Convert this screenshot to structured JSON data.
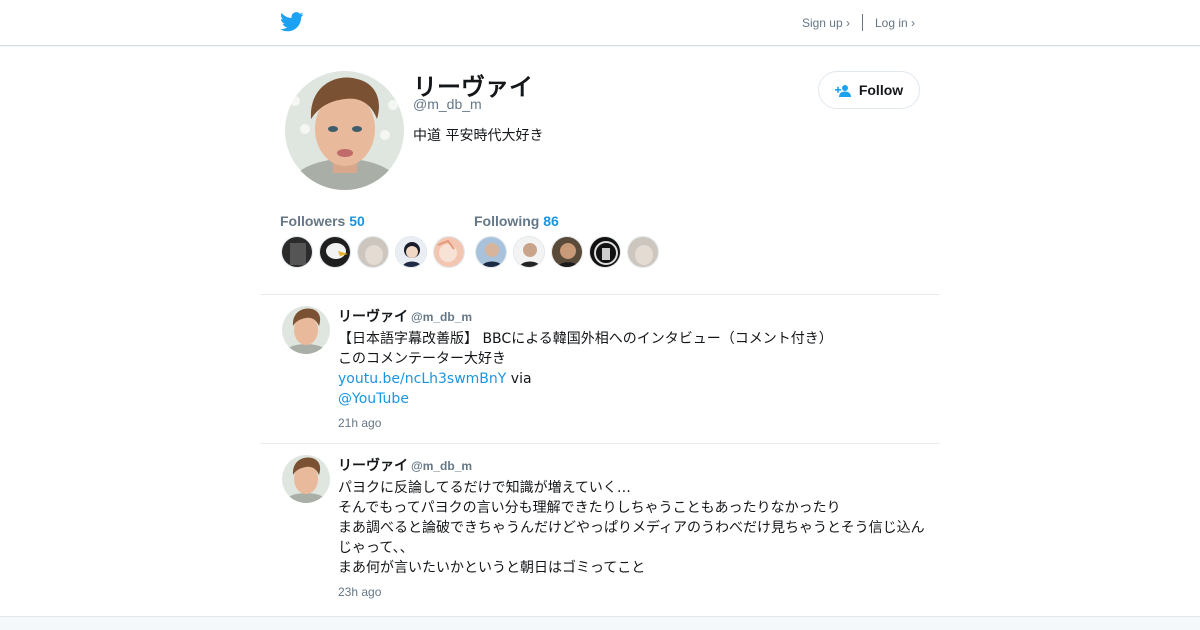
{
  "colors": {
    "accent": "#1b95e0",
    "twitter_blue": "#1da1f2",
    "muted": "#657786"
  },
  "header": {
    "logo_icon": "twitter-bird-icon",
    "signup_label": "Sign up ›",
    "login_label": "Log in ›"
  },
  "profile": {
    "name": "リーヴァイ",
    "handle": "@m_db_m",
    "bio": "中道 平安時代大好き",
    "follow_label": "Follow",
    "follow_icon": "add-user-icon",
    "followers_label": "Followers",
    "followers_count": "50",
    "following_label": "Following",
    "following_count": "86"
  },
  "tweets": [
    {
      "name": "リーヴァイ",
      "handle": "@m_db_m",
      "line1": "【日本語字幕改善版】 BBCによる韓国外相へのインタビュー（コメント付き）",
      "line2": "このコメンテーター大好き",
      "link": "youtu.be/ncLh3swmBnY",
      "via": " via",
      "mention": "@YouTube",
      "time": "21h ago"
    },
    {
      "name": "リーヴァイ",
      "handle": "@m_db_m",
      "line1": "パヨクに反論してるだけで知識が増えていく…",
      "line2": "そんでもってパヨクの言い分も理解できたりしちゃうこともあったりなかったり",
      "line3": "まあ調べると論破できちゃうんだけどやっぱりメディアのうわべだけ見ちゃうとそう信じ込ん",
      "line4": "じゃって、、",
      "line5": "まあ何が言いたいかというと朝日はゴミってこと",
      "time": "23h ago"
    }
  ]
}
